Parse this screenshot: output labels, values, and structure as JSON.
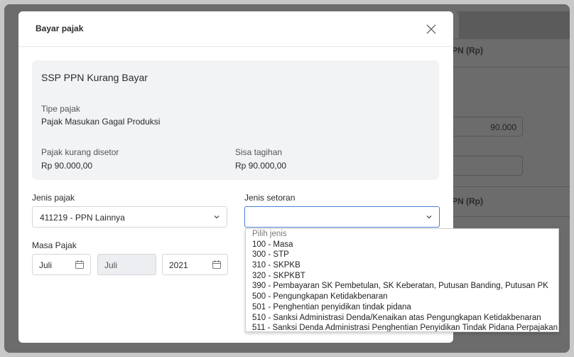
{
  "background": {
    "header_1": "PN (Rp)",
    "header_2": "PN (Rp)",
    "value_1": "90.000"
  },
  "modal": {
    "title": "Bayar pajak",
    "info": {
      "title": "SSP PPN Kurang Bayar",
      "tipe_label": "Tipe pajak",
      "tipe_value": "Pajak Masukan Gagal Produksi",
      "kurang_label": "Pajak kurang disetor",
      "kurang_value": "Rp 90.000,00",
      "sisa_label": "Sisa tagihan",
      "sisa_value": "Rp 90.000,00"
    },
    "jenis_pajak": {
      "label": "Jenis pajak",
      "value": "411219 - PPN Lainnya"
    },
    "jenis_setoran": {
      "label": "Jenis setoran",
      "value": ""
    },
    "masa_pajak": {
      "label": "Masa Pajak",
      "from_month": "Juli",
      "to_month": "Juli",
      "year": "2021"
    }
  },
  "dropdown": {
    "options": [
      "Pilih jenis",
      "100 - Masa",
      "300 - STP",
      "310 - SKPKB",
      "320 - SKPKBT",
      "390 - Pembayaran SK Pembetulan, SK Keberatan, Putusan Banding, Putusan PK",
      "500 - Pengungkapan Ketidakbenaran",
      "501 - Penghentian penyidikan tindak pidana",
      "510 - Sanksi Administrasi Denda/Kenaikan atas Pengungkapan Ketidakbenaran",
      "511 - Sanksi Denda Administrasi Penghentian Penyidikan Tindak Pidana Perpajakan"
    ]
  },
  "colors": {
    "accent": "#4a7fd0",
    "info_bg": "#f2f3f5"
  }
}
